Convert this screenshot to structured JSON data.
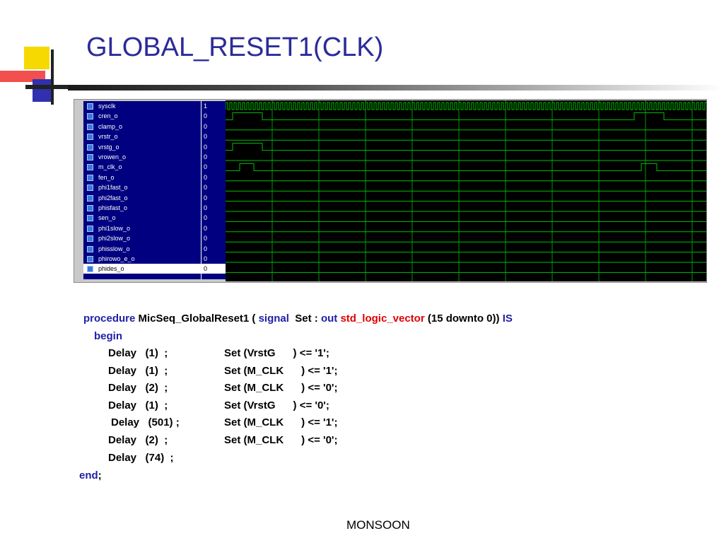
{
  "slide": {
    "title": "GLOBAL_RESET1(CLK)",
    "footer": "MONSOON"
  },
  "colors": {
    "title": "#2b2b9a",
    "keyword": "#2020a8",
    "type_keyword": "#e00000",
    "wave_bg": "#000000",
    "wave_line": "#00c000",
    "signal_list_bg": "#000080"
  },
  "signals": [
    {
      "name": "sysclk",
      "value": "1"
    },
    {
      "name": "cren_o",
      "value": "0"
    },
    {
      "name": "clamp_o",
      "value": "0"
    },
    {
      "name": "vrstr_o",
      "value": "0"
    },
    {
      "name": "vrstg_o",
      "value": "0"
    },
    {
      "name": "vrowen_o",
      "value": "0"
    },
    {
      "name": "m_clk_o",
      "value": "0"
    },
    {
      "name": "fen_o",
      "value": "0"
    },
    {
      "name": "phi1fast_o",
      "value": "0"
    },
    {
      "name": "phi2fast_o",
      "value": "0"
    },
    {
      "name": "phisfast_o",
      "value": "0"
    },
    {
      "name": "sen_o",
      "value": "0"
    },
    {
      "name": "phi1slow_o",
      "value": "0"
    },
    {
      "name": "phi2slow_o",
      "value": "0"
    },
    {
      "name": "phisslow_o",
      "value": "0"
    },
    {
      "name": "phirowo_e_o",
      "value": "0"
    },
    {
      "name": "phides_o",
      "value": "0"
    }
  ],
  "code": {
    "l1": {
      "kw_procedure": "procedure",
      "name": " MicSeq_GlobalReset1 ( ",
      "kw_signal": "signal",
      "param": "  Set : ",
      "kw_out": "out",
      "sp": " ",
      "type": "std_logic_vector",
      "range": " (15 downto 0)) ",
      "kw_is": "IS"
    },
    "begin": "begin",
    "rows": [
      {
        "delay": "Delay   (1)  ;",
        "set": "Set (VrstG      ) <= '1';"
      },
      {
        "delay": "Delay   (1)  ;",
        "set": "Set (M_CLK      ) <= '1';"
      },
      {
        "delay": "Delay   (2)  ;",
        "set": "Set (M_CLK      ) <= '0';"
      },
      {
        "delay": "Delay   (1)  ;",
        "set": "Set (VrstG      ) <= '0';"
      },
      {
        "delay": "Delay   (501) ;",
        "set": "Set (M_CLK      ) <= '1';"
      },
      {
        "delay": "Delay   (2)  ;",
        "set": "Set (M_CLK      ) <= '0';"
      },
      {
        "delay": "Delay   (74)  ;",
        "set": ""
      }
    ],
    "end_kw": "end",
    "end_semi": ";"
  }
}
